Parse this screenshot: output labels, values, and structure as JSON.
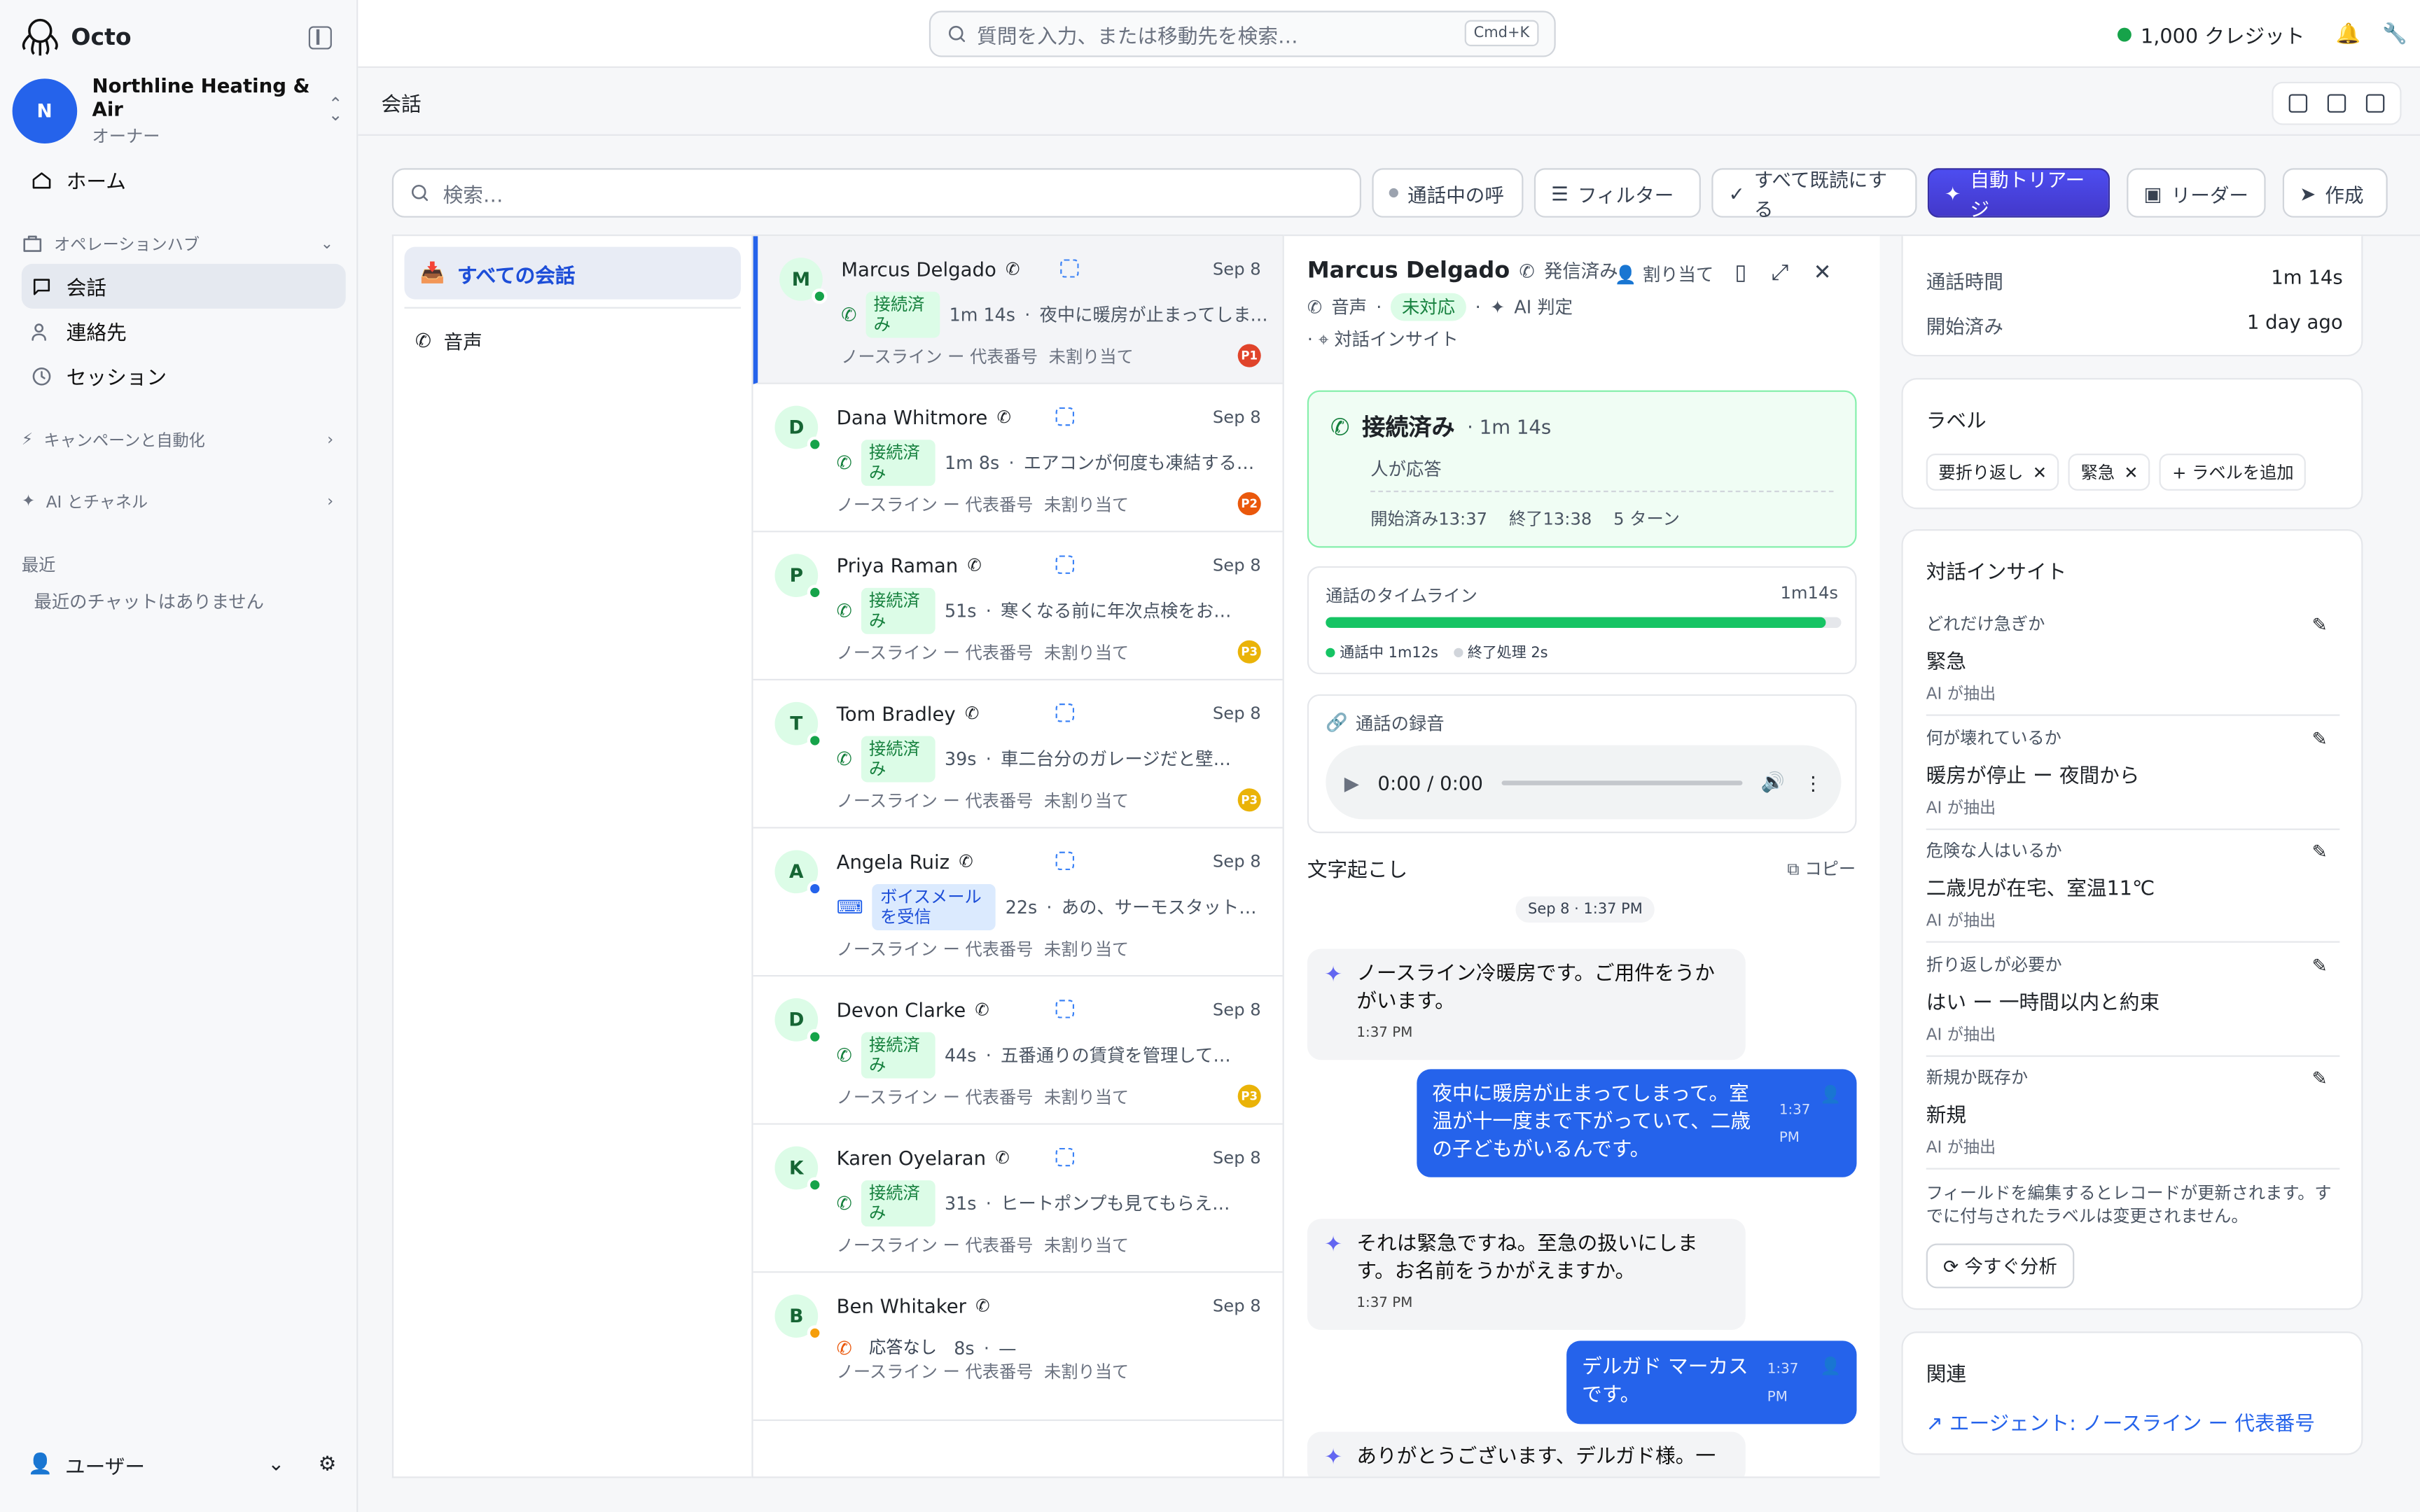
{
  "app": {
    "name": "Octo"
  },
  "org": {
    "initial": "N",
    "name": "Northline Heating & Air",
    "role": "オーナー"
  },
  "nav": {
    "home": "ホーム",
    "ops_hub": "オペレーションハブ",
    "conversations": "会話",
    "contacts": "連絡先",
    "sessions": "セッション",
    "campaigns": "キャンペーンと自動化",
    "ai_channels": "AI とチャネル",
    "recent_header": "最近",
    "recent_empty": "最近のチャットはありません",
    "user": "ユーザー"
  },
  "topbar": {
    "search_placeholder": "質問を入力、または移動先を検索…",
    "shortcut": "Cmd+K",
    "credits": "1,000 クレジット"
  },
  "header": {
    "title": "会話"
  },
  "toolbar": {
    "search_placeholder": "検索…",
    "active_calls": "通話中の呼",
    "filter": "フィルター",
    "mark_all_read": "すべて既読にする",
    "auto_triage": "自動トリアージ",
    "reader": "リーダー",
    "compose": "作成"
  },
  "filters": {
    "all": "すべての会話",
    "voice": "音声"
  },
  "conversations": [
    {
      "initial": "M",
      "name": "Marcus Delgado",
      "date": "Sep 8",
      "status": "接続済み",
      "duration": "1m 14s",
      "snippet": "夜中に暖房が止まってしまっ…",
      "sub": "ノースライン ー 代表番号",
      "assign": "未割り当て",
      "priority": "P1",
      "prio_color": "#e0442b",
      "dot": "#16a34a",
      "status_kind": "connected"
    },
    {
      "initial": "D",
      "name": "Dana Whitmore",
      "date": "Sep 8",
      "status": "接続済み",
      "duration": "1m 8s",
      "snippet": "エアコンが何度も凍結するん…",
      "sub": "ノースライン ー 代表番号",
      "assign": "未割り当て",
      "priority": "P2",
      "prio_color": "#ea580c",
      "dot": "#16a34a",
      "status_kind": "connected"
    },
    {
      "initial": "P",
      "name": "Priya Raman",
      "date": "Sep 8",
      "status": "接続済み",
      "duration": "51s",
      "snippet": "寒くなる前に年次点検をお願…",
      "sub": "ノースライン ー 代表番号",
      "assign": "未割り当て",
      "priority": "P3",
      "prio_color": "#eab308",
      "dot": "#16a34a",
      "status_kind": "connected"
    },
    {
      "initial": "T",
      "name": "Tom Bradley",
      "date": "Sep 8",
      "status": "接続済み",
      "duration": "39s",
      "snippet": "車二台分のガレージだと壁掛け…",
      "sub": "ノースライン ー 代表番号",
      "assign": "未割り当て",
      "priority": "P3",
      "prio_color": "#eab308",
      "dot": "#16a34a",
      "status_kind": "connected"
    },
    {
      "initial": "A",
      "name": "Angela Ruiz",
      "date": "Sep 8",
      "status": "ボイスメールを受信",
      "duration": "22s",
      "snippet": "あの、サーモスタットの…",
      "sub": "ノースライン ー 代表番号",
      "assign": "未割り当て",
      "priority": "",
      "prio_color": "",
      "dot": "#2563eb",
      "status_kind": "voicemail"
    },
    {
      "initial": "D",
      "name": "Devon Clarke",
      "date": "Sep 8",
      "status": "接続済み",
      "duration": "44s",
      "snippet": "五番通りの賃貸を管理していま…",
      "sub": "ノースライン ー 代表番号",
      "assign": "未割り当て",
      "priority": "P3",
      "prio_color": "#eab308",
      "dot": "#16a34a",
      "status_kind": "connected"
    },
    {
      "initial": "K",
      "name": "Karen Oyelaran",
      "date": "Sep 8",
      "status": "接続済み",
      "duration": "31s",
      "snippet": "ヒートポンプも見てもらえま…",
      "sub": "ノースライン ー 代表番号",
      "assign": "未割り当て",
      "priority": "",
      "prio_color": "",
      "dot": "#16a34a",
      "status_kind": "connected"
    },
    {
      "initial": "B",
      "name": "Ben Whitaker",
      "date": "Sep 8",
      "status": "応答なし",
      "duration": "8s",
      "snippet": "—",
      "sub": "ノースライン ー 代表番号",
      "assign": "未割り当て",
      "priority": "",
      "prio_color": "",
      "dot": "#f59e0b",
      "status_kind": "missed"
    }
  ],
  "detail": {
    "name": "Marcus Delgado",
    "direction": "発信済み",
    "assign": "割り当て",
    "channel": "音声",
    "state": "未対応",
    "ai": "AI 判定",
    "insight_link": "対話インサイト",
    "call_status": "接続済み",
    "call_duration": "· 1m 14s",
    "answered_by": "人が応答",
    "started": "開始済み13:37",
    "ended": "終了13:38",
    "turns": "5 ターン",
    "timeline_label": "通話のタイムライン",
    "timeline_total": "1m14s",
    "timeline_progress": 0.97,
    "legend_in_call": "通話中 1m12s",
    "legend_wrap": "終了処理 2s",
    "recording_label": "通話の録音",
    "player_time": "0:00 / 0:00",
    "transcript_label": "文字起こし",
    "copy": "コピー",
    "timestamp": "Sep 8 · 1:37 PM"
  },
  "transcript": [
    {
      "role": "ai",
      "text": "ノースライン冷暖房です。ご用件をうかがいます。",
      "time": "1:37 PM"
    },
    {
      "role": "user",
      "text": "夜中に暖房が止まってしまって。室温が十一度まで下がっていて、二歳の子どもがいるんです。",
      "time": "1:37 PM"
    },
    {
      "role": "ai",
      "text": "それは緊急ですね。至急の扱いにします。お名前をうかがえますか。",
      "time": "1:37 PM"
    },
    {
      "role": "user",
      "text": "デルガド マーカスです。",
      "time": "1:37 PM"
    },
    {
      "role": "ai",
      "text": "ありがとうございます、デルガド様。一",
      "time": ""
    }
  ],
  "right": {
    "kv": [
      {
        "k": "通話時間",
        "v": "1m 14s"
      },
      {
        "k": "開始済み",
        "v": "1 day ago"
      }
    ],
    "labels_title": "ラベル",
    "labels": [
      "要折り返し",
      "緊急"
    ],
    "add_label": "+ ラベルを追加",
    "insights_title": "対話インサイト",
    "insights": [
      {
        "q": "どれだけ急ぎか",
        "a": "緊急",
        "s": "AI が抽出"
      },
      {
        "q": "何が壊れているか",
        "a": "暖房が停止 ー 夜間から",
        "s": "AI が抽出"
      },
      {
        "q": "危険な人はいるか",
        "a": "二歳児が在宅、室温11℃",
        "s": "AI が抽出"
      },
      {
        "q": "折り返しが必要か",
        "a": "はい ー 一時間以内と約束",
        "s": "AI が抽出"
      },
      {
        "q": "新規か既存か",
        "a": "新規",
        "s": "AI が抽出"
      }
    ],
    "note": "フィールドを編集するとレコードが更新されます。すでに付与されたラベルは変更されません。",
    "analyze": "今すぐ分析",
    "related_title": "関連",
    "related_link": "エージェント: ノースライン ー 代表番号"
  }
}
